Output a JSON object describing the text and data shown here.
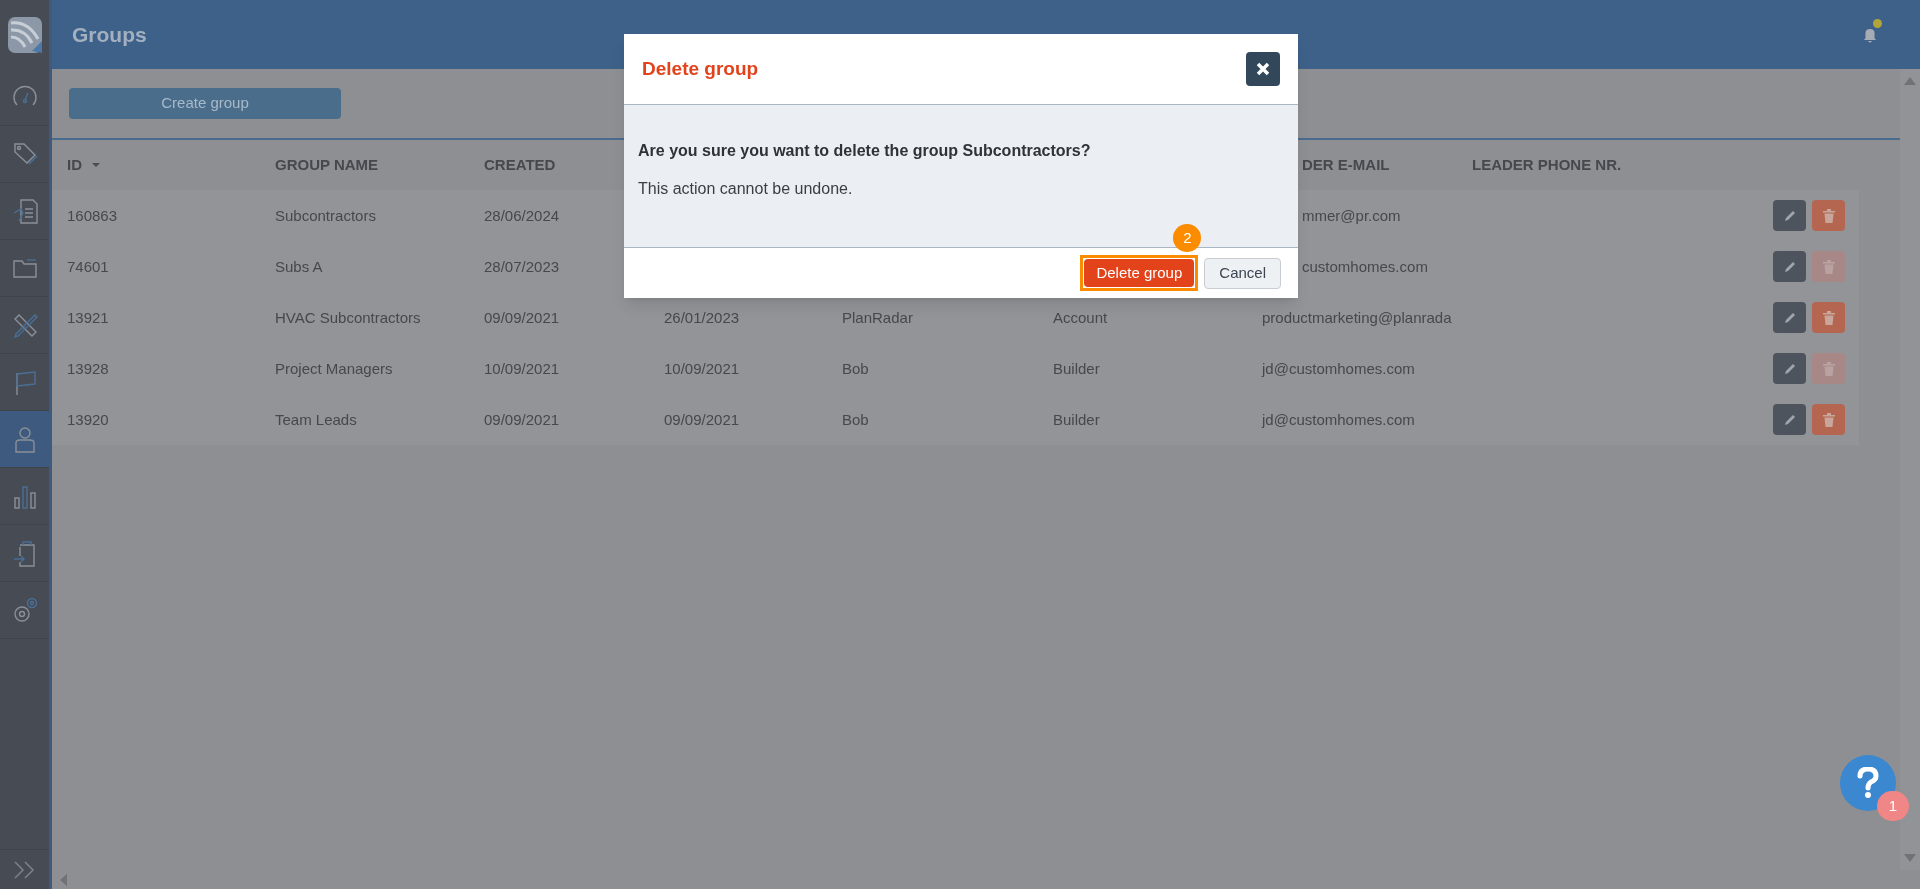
{
  "header": {
    "title": "Groups",
    "notification_dot": true
  },
  "sidebar": {
    "items": [
      {
        "kind": "dashboard",
        "selected": false
      },
      {
        "kind": "tags",
        "selected": false
      },
      {
        "kind": "reports",
        "selected": false
      },
      {
        "kind": "folder",
        "selected": false
      },
      {
        "kind": "tools",
        "selected": false
      },
      {
        "kind": "flag",
        "selected": false
      },
      {
        "kind": "user",
        "selected": true
      },
      {
        "kind": "stats",
        "selected": false
      },
      {
        "kind": "clipboard",
        "selected": false
      },
      {
        "kind": "settings",
        "selected": false
      }
    ]
  },
  "toolbar": {
    "create_button": "Create group"
  },
  "table": {
    "columns": [
      {
        "label": "ID",
        "sorted": true
      },
      {
        "label": "GROUP NAME"
      },
      {
        "label": "CREATED"
      },
      null,
      null,
      null,
      {
        "label": "DER E-MAIL",
        "cut": true
      },
      {
        "label": "LEADER PHONE NR."
      }
    ],
    "rows": [
      {
        "cells": [
          "160863",
          "Subcontractors",
          "28/06/2024",
          null,
          null,
          null,
          {
            "text": "mmer@pr.com",
            "cut": true
          },
          null
        ],
        "delete_disabled": false
      },
      {
        "cells": [
          "74601",
          "Subs A",
          "28/07/2023",
          null,
          null,
          null,
          {
            "text": "customhomes.com",
            "cut": true
          },
          null
        ],
        "delete_disabled": true
      },
      {
        "cells": [
          "13921",
          "HVAC Subcontractors",
          "09/09/2021",
          "26/01/2023",
          "PlanRadar",
          "Account",
          "productmarketing@planrada",
          null
        ],
        "delete_disabled": false
      },
      {
        "cells": [
          "13928",
          "Project Managers",
          "10/09/2021",
          "10/09/2021",
          "Bob",
          "Builder",
          "jd@customhomes.com",
          null
        ],
        "delete_disabled": true
      },
      {
        "cells": [
          "13920",
          "Team Leads",
          "09/09/2021",
          "09/09/2021",
          "Bob",
          "Builder",
          "jd@customhomes.com",
          null
        ],
        "delete_disabled": false
      }
    ]
  },
  "dialog": {
    "title": "Delete group",
    "question": "Are you sure you want to delete the group Subcontractors?",
    "note": "This action cannot be undone.",
    "confirm": "Delete group",
    "cancel": "Cancel",
    "step_badge": "2"
  },
  "help": {
    "badge": "1"
  }
}
